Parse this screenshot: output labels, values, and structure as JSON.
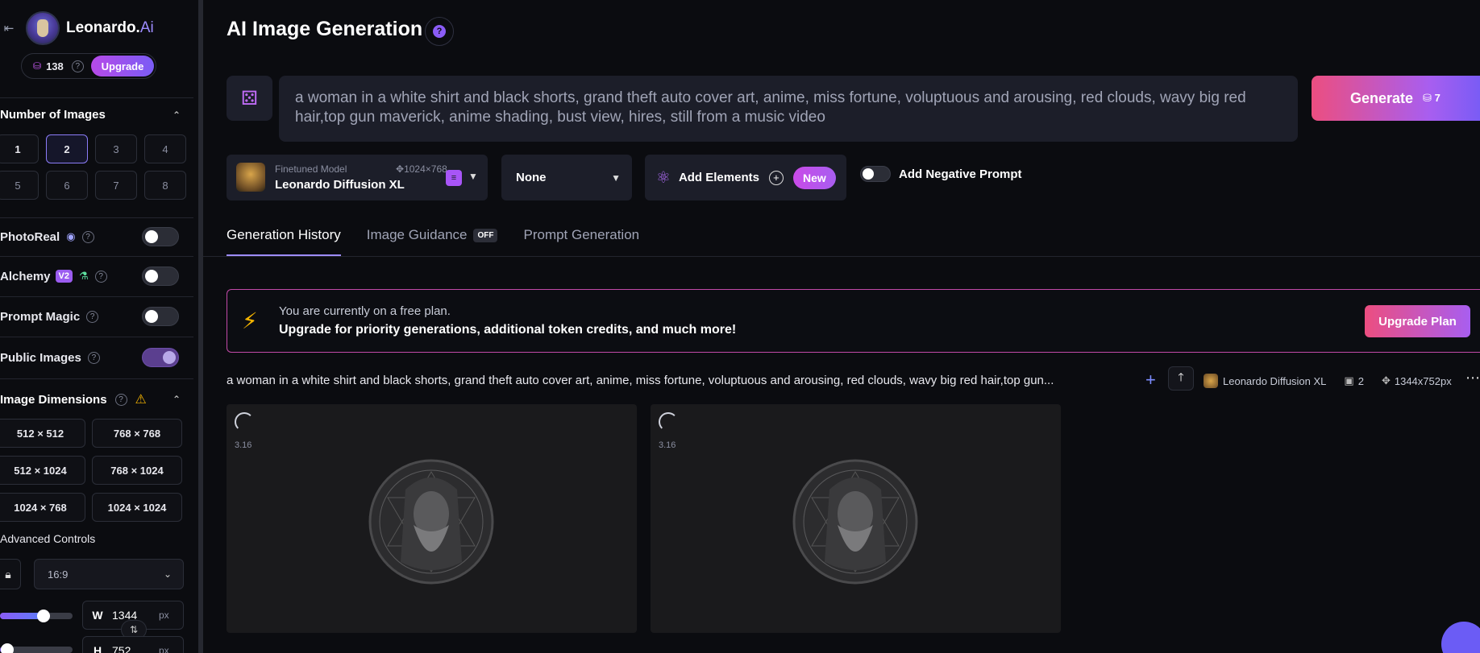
{
  "brand": {
    "name": "Leonardo.",
    "name_suffix": "Ai",
    "collapse_icon": "arrow-left-icon"
  },
  "tokens": {
    "count": "138",
    "help": "?",
    "upgrade_label": "Upgrade"
  },
  "sidebar": {
    "number_of_images": {
      "title": "Number of Images",
      "options": [
        "1",
        "2",
        "3",
        "4",
        "5",
        "6",
        "7",
        "8"
      ],
      "selected": "2"
    },
    "photoreal": {
      "label": "PhotoReal",
      "enabled": false
    },
    "alchemy": {
      "label": "Alchemy",
      "badge": "V2",
      "enabled": false
    },
    "prompt_magic": {
      "label": "Prompt Magic",
      "enabled": false
    },
    "public_images": {
      "label": "Public Images",
      "enabled": true
    },
    "image_dimensions": {
      "title": "Image Dimensions",
      "options": [
        "512 × 512",
        "768 × 768",
        "512 × 1024",
        "768 × 1024",
        "1024 × 768",
        "1024 × 1024"
      ]
    },
    "advanced_controls": {
      "label": "Advanced Controls",
      "aspect_ratio": "16:9",
      "width": {
        "key": "W",
        "value": "1344",
        "unit": "px",
        "slider_fraction": 0.6
      },
      "height": {
        "key": "H",
        "value": "752",
        "unit": "px",
        "slider_fraction": 0.1
      }
    }
  },
  "header": {
    "title": "AI Image Generation",
    "help": "?"
  },
  "prompt": {
    "text": "a woman in a white shirt and black shorts, grand theft auto cover art, anime, miss fortune, voluptuous and arousing, red clouds, wavy big red hair,top gun maverick, anime shading, bust view, hires, still from a music video",
    "generate_label": "Generate",
    "generate_cost": "7"
  },
  "model": {
    "kicker": "Finetuned Model",
    "dims": "1024×768",
    "name": "Leonardo Diffusion XL"
  },
  "style": {
    "value": "None"
  },
  "elements": {
    "label": "Add Elements",
    "badge": "New"
  },
  "negative_prompt": {
    "label": "Add Negative Prompt",
    "enabled": false
  },
  "tabs": [
    {
      "label": "Generation History",
      "active": true
    },
    {
      "label": "Image Guidance",
      "badge": "OFF",
      "active": false
    },
    {
      "label": "Prompt Generation",
      "active": false
    }
  ],
  "banner": {
    "line1": "You are currently on a free plan.",
    "line2": "Upgrade for priority generations, additional token credits, and much more!",
    "button": "Upgrade Plan"
  },
  "generation": {
    "prompt": "a woman in a white shirt and black shorts, grand theft auto cover art, anime, miss fortune, voluptuous and arousing, red clouds, wavy big red hair,top gun...",
    "model": "Leonardo Diffusion XL",
    "count": "2",
    "size": "1344x752px",
    "cards": [
      {
        "time": "3.16"
      },
      {
        "time": "3.16"
      }
    ]
  },
  "colors": {
    "accent": "#9d8cff",
    "generate_start": "#ec4e80",
    "generate_end": "#7a5cf5",
    "warning": "#f5b400"
  }
}
